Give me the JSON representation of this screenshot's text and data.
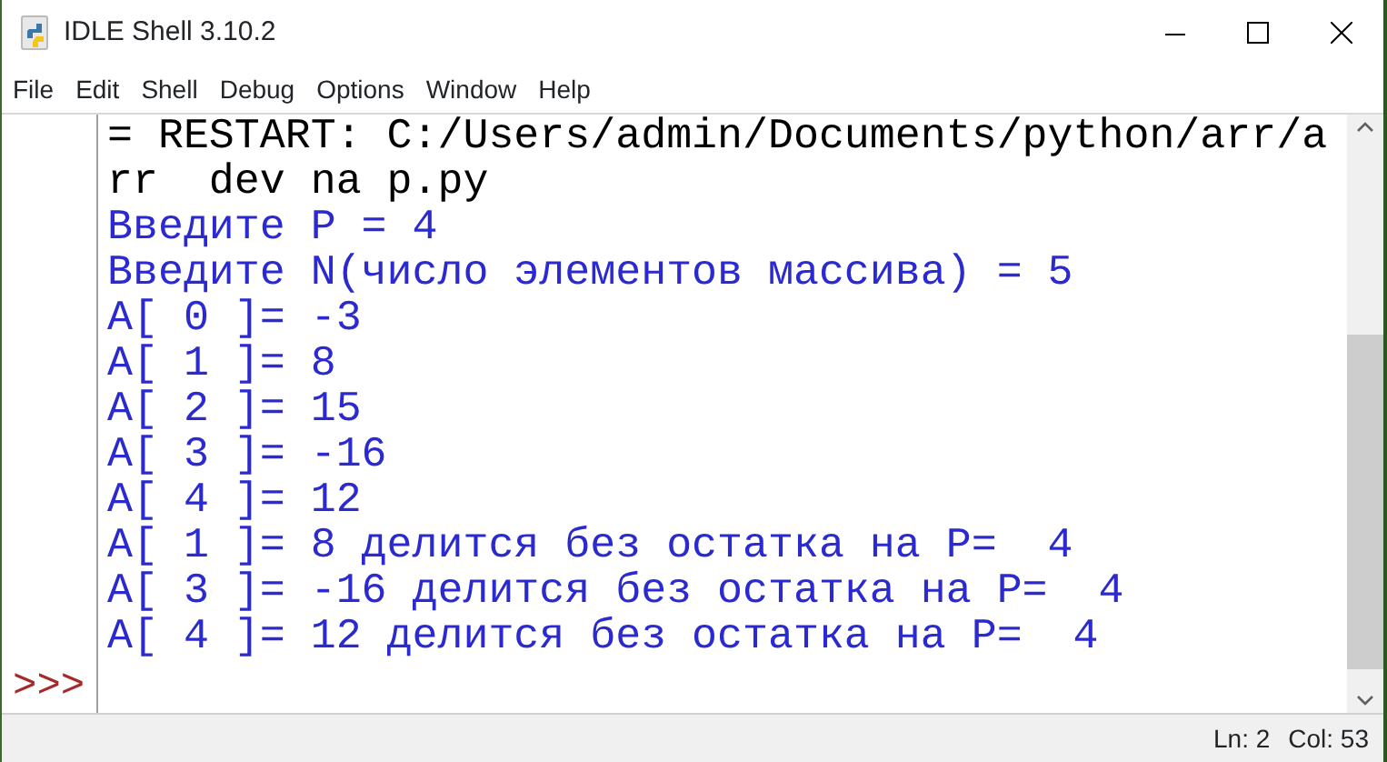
{
  "window": {
    "title": "IDLE Shell 3.10.2"
  },
  "menu": [
    "File",
    "Edit",
    "Shell",
    "Debug",
    "Options",
    "Window",
    "Help"
  ],
  "shell": {
    "lines": [
      {
        "kind": "restart",
        "text": "= RESTART: C:/Users/admin/Documents/python/arr/a"
      },
      {
        "kind": "restart",
        "text": "rr  dev na p.py"
      },
      {
        "kind": "stdout",
        "text": "Введите P = 4"
      },
      {
        "kind": "stdout",
        "text": "Введите N(число элементов массива) = 5"
      },
      {
        "kind": "stdout",
        "text": "A[ 0 ]= -3"
      },
      {
        "kind": "stdout",
        "text": "A[ 1 ]= 8"
      },
      {
        "kind": "stdout",
        "text": "A[ 2 ]= 15"
      },
      {
        "kind": "stdout",
        "text": "A[ 3 ]= -16"
      },
      {
        "kind": "stdout",
        "text": "A[ 4 ]= 12"
      },
      {
        "kind": "stdout",
        "text": "A[ 1 ]= 8 делится без остатка на P=  4"
      },
      {
        "kind": "stdout",
        "text": "A[ 3 ]= -16 делится без остатка на P=  4"
      },
      {
        "kind": "stdout",
        "text": "A[ 4 ]= 12 делится без остатка на P=  4"
      }
    ],
    "prompt": ">>>"
  },
  "status_bar": {
    "line": "Ln: 2",
    "column": "Col: 53"
  }
}
